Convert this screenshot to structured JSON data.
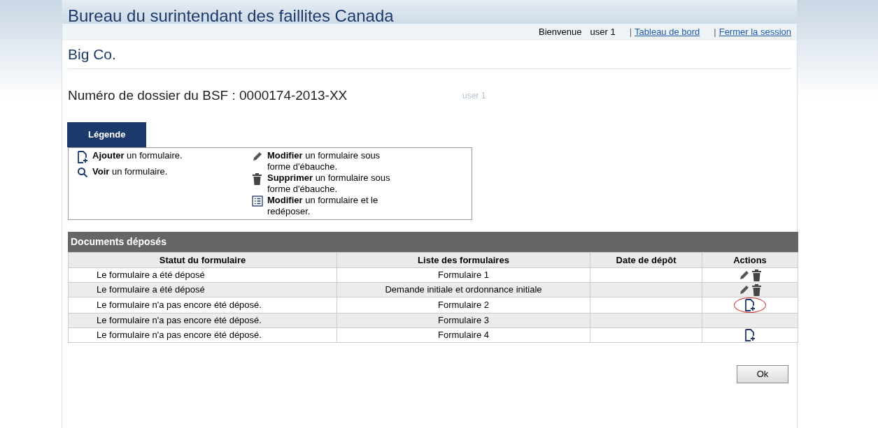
{
  "header": {
    "title": "Bureau du surintendant des faillites Canada",
    "welcome": "Bienvenue",
    "user": "user 1",
    "links": [
      {
        "sep": "|",
        "label": "Tableau de bord"
      },
      {
        "sep": "|",
        "label": "Fermer la session"
      }
    ]
  },
  "company": "Big Co.",
  "file_number": "Numéro de dossier du BSF : 0000174-2013-XX",
  "ghost_text": "user 1",
  "legend": {
    "tab": "Légende",
    "columns": [
      [
        {
          "kind": "add",
          "text": "**Ajouter** un formulaire."
        },
        {
          "kind": "view",
          "text": "**Voir** un formulaire."
        }
      ],
      [
        {
          "kind": "edit",
          "text": "**Modifier** un formulaire sous forme d'ébauche."
        },
        {
          "kind": "delete",
          "text": "**Supprimer** un formulaire sous forme d'ébauche."
        },
        {
          "kind": "resubmit",
          "text": "**Modifier** un formulaire et le redéposer."
        }
      ]
    ]
  },
  "table": {
    "title": "Documents déposés",
    "columns": [
      "Statut du formulaire",
      "Liste des formulaires",
      "Date de dépôt",
      "Actions"
    ],
    "rows": [
      {
        "status": "Le formulaire a été déposé",
        "form": "Formulaire 1",
        "actions": [
          {
            "kind": "edit"
          },
          {
            "kind": "delete"
          }
        ],
        "highlighted": false
      },
      {
        "status": "Le formulaire a été déposé",
        "form": "Demande initiale et ordonnance initiale",
        "actions": [
          {
            "kind": "edit"
          },
          {
            "kind": "delete"
          }
        ],
        "highlighted": false
      },
      {
        "status": "Le formulaire n'a pas encore été déposé.",
        "form": "Formulaire 2",
        "actions": [
          {
            "kind": "add"
          }
        ],
        "highlighted": true
      },
      {
        "status": "Le formulaire n'a pas encore été déposé.",
        "form": "Formulaire 3",
        "actions": [],
        "highlighted": false
      },
      {
        "status": "Le formulaire n'a pas encore été déposé.",
        "form": "Formulaire 4",
        "actions": [
          {
            "kind": "add"
          }
        ],
        "highlighted": false
      }
    ]
  },
  "ok_button": "Ok"
}
